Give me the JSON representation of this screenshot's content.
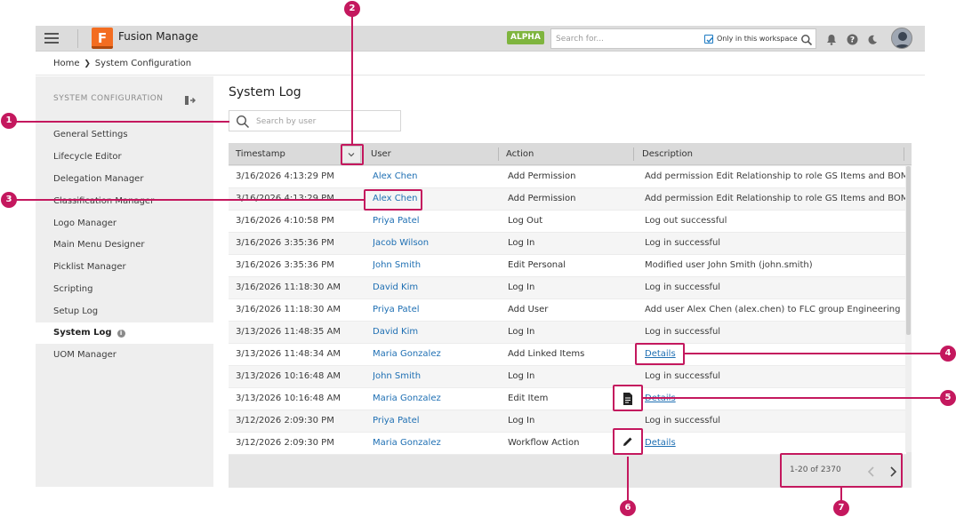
{
  "app": {
    "name": "Fusion Manage",
    "logo_letter": "F",
    "badge": "ALPHA"
  },
  "topbar": {
    "search_placeholder": "Search for...",
    "workspace_filter_label": "Only in this workspace",
    "workspace_filter_checked": true
  },
  "breadcrumb": {
    "home": "Home",
    "current": "System Configuration"
  },
  "sidebar": {
    "title": "SYSTEM CONFIGURATION",
    "items": [
      {
        "label": "General Settings"
      },
      {
        "label": "Lifecycle Editor"
      },
      {
        "label": "Delegation Manager"
      },
      {
        "label": "Classification Manager"
      },
      {
        "label": "Logo Manager"
      },
      {
        "label": "Main Menu Designer"
      },
      {
        "label": "Picklist Manager"
      },
      {
        "label": "Scripting"
      },
      {
        "label": "Setup Log"
      },
      {
        "label": "System Log",
        "active": true,
        "info": "i"
      },
      {
        "label": "UOM Manager"
      }
    ]
  },
  "main": {
    "title": "System Log",
    "user_search_placeholder": "Search by user",
    "columns": [
      "Timestamp",
      "User",
      "Action",
      "Description"
    ],
    "rows": [
      {
        "timestamp": "3/16/2026 4:13:29 PM",
        "user": "Alex Chen",
        "action": "Add Permission",
        "description": "Add permission Edit Relationship to role GS Items and BOMs [R/"
      },
      {
        "timestamp": "3/16/2026 4:13:29 PM",
        "user": "Alex Chen",
        "action": "Add Permission",
        "description": "Add permission Edit Relationship to role GS Items and BOMs [R/"
      },
      {
        "timestamp": "3/16/2026 4:10:58 PM",
        "user": "Priya Patel",
        "action": "Log Out",
        "description": "Log out successful"
      },
      {
        "timestamp": "3/16/2026 3:35:36 PM",
        "user": "Jacob Wilson",
        "action": "Log In",
        "description": "Log in successful"
      },
      {
        "timestamp": "3/16/2026 3:35:36 PM",
        "user": "John Smith",
        "action": "Edit Personal",
        "description": "Modified user John Smith (john.smith)"
      },
      {
        "timestamp": "3/16/2026 11:18:30 AM",
        "user": "David Kim",
        "action": "Log In",
        "description": "Log in successful"
      },
      {
        "timestamp": "3/16/2026 11:18:30 AM",
        "user": "Priya Patel",
        "action": "Add User",
        "description": "Add user Alex Chen (alex.chen) to FLC group Engineering"
      },
      {
        "timestamp": "3/13/2026 11:48:35 AM",
        "user": "David Kim",
        "action": "Log In",
        "description": "Log in successful"
      },
      {
        "timestamp": "3/13/2026 11:48:34 AM",
        "user": "Maria Gonzalez",
        "action": "Add Linked Items",
        "description": "Details",
        "link": true
      },
      {
        "timestamp": "3/13/2026 10:16:48 AM",
        "user": "John Smith",
        "action": "Log In",
        "description": "Log in successful"
      },
      {
        "timestamp": "3/13/2026 10:16:48 AM",
        "user": "Maria Gonzalez",
        "action": "Edit Item",
        "description": "Details",
        "link": true
      },
      {
        "timestamp": "3/12/2026 2:09:30 PM",
        "user": "Priya Patel",
        "action": "Log In",
        "description": "Log in successful"
      },
      {
        "timestamp": "3/12/2026 2:09:30 PM",
        "user": "Maria Gonzalez",
        "action": "Workflow Action",
        "description": "Details",
        "link": true
      }
    ],
    "pager": {
      "range": "1-20 of 2370"
    }
  },
  "annotations": [
    "1",
    "2",
    "3",
    "4",
    "5",
    "6",
    "7"
  ],
  "colors": {
    "annotation": "#c4185e",
    "link": "#1e6fb3",
    "alpha_badge": "#7fb53f",
    "logo": "#f36d21"
  }
}
